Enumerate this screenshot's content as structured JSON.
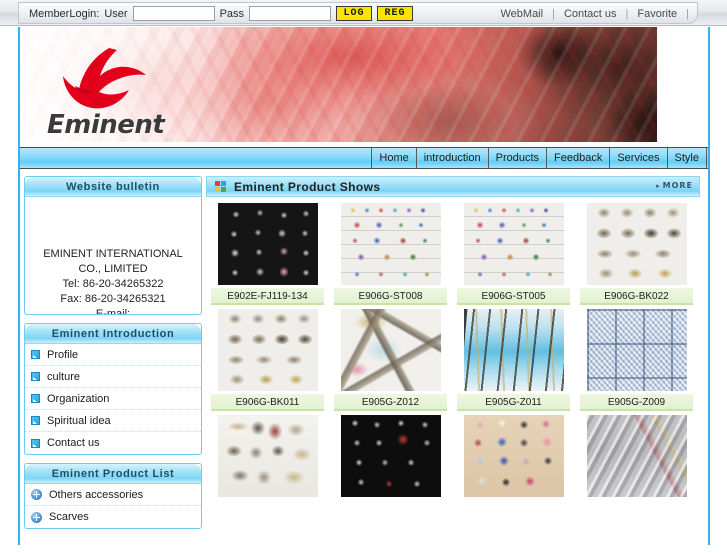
{
  "topbar": {
    "login_label": "MemberLogin:",
    "user_label": "User",
    "user_value": "",
    "user_placeholder": "",
    "pass_label": "Pass",
    "pass_value": "",
    "pass_placeholder": "",
    "log_button": "LOG",
    "reg_button": "REG",
    "links": [
      {
        "label": "WebMail"
      },
      {
        "label": "Contact us"
      },
      {
        "label": "Favorite"
      }
    ]
  },
  "banner": {
    "logo_text": "Eminent"
  },
  "nav": {
    "items": [
      {
        "label": "Home"
      },
      {
        "label": "introduction"
      },
      {
        "label": "Products"
      },
      {
        "label": "Feedback"
      },
      {
        "label": "Services"
      },
      {
        "label": "Style"
      }
    ]
  },
  "sidebar": {
    "bulletin": {
      "title": "Website bulletin",
      "lines": [
        "EMINENT INTERNATIONAL",
        "CO., LIMITED",
        "Tel: 86-20-34265322",
        "Fax: 86-20-34265321",
        "E-mail:"
      ]
    },
    "introduction": {
      "title": "Eminent Introduction",
      "items": [
        {
          "label": "Profile"
        },
        {
          "label": "culture"
        },
        {
          "label": "Organization"
        },
        {
          "label": "Spiritual idea"
        },
        {
          "label": "Contact us"
        }
      ]
    },
    "product_list": {
      "title": "Eminent Product List",
      "items": [
        {
          "label": "Others accessories"
        },
        {
          "label": "Scarves"
        }
      ]
    }
  },
  "main": {
    "panel_title": "Eminent Product Shows",
    "more_label": "MORE",
    "products": [
      {
        "code": "E902E-FJ119-134",
        "texture": "tx-dark-jewel"
      },
      {
        "code": "E906G-ST008",
        "texture": "tx-card-grid"
      },
      {
        "code": "E906G-ST005",
        "texture": "tx-card-grid"
      },
      {
        "code": "E906G-BK022",
        "texture": "tx-buckle"
      },
      {
        "code": "E906G-BK011",
        "texture": "tx-buckle"
      },
      {
        "code": "E905G-Z012",
        "texture": "tx-appliq"
      },
      {
        "code": "E905G-Z011",
        "texture": "tx-trim-blue"
      },
      {
        "code": "E905G-Z009",
        "texture": "tx-lace-panel"
      },
      {
        "code": "",
        "texture": "tx-neck-light"
      },
      {
        "code": "",
        "texture": "tx-black-charm"
      },
      {
        "code": "",
        "texture": "tx-flower-ring"
      },
      {
        "code": "",
        "texture": "tx-ribbon-roll"
      }
    ]
  },
  "colors": {
    "accent_blue": "#35b3e8",
    "nav_blue": "#8ddcfa",
    "caption_green": "#e8f4d8",
    "button_yellow": "#fbe400",
    "logo_red": "#e2001a"
  }
}
